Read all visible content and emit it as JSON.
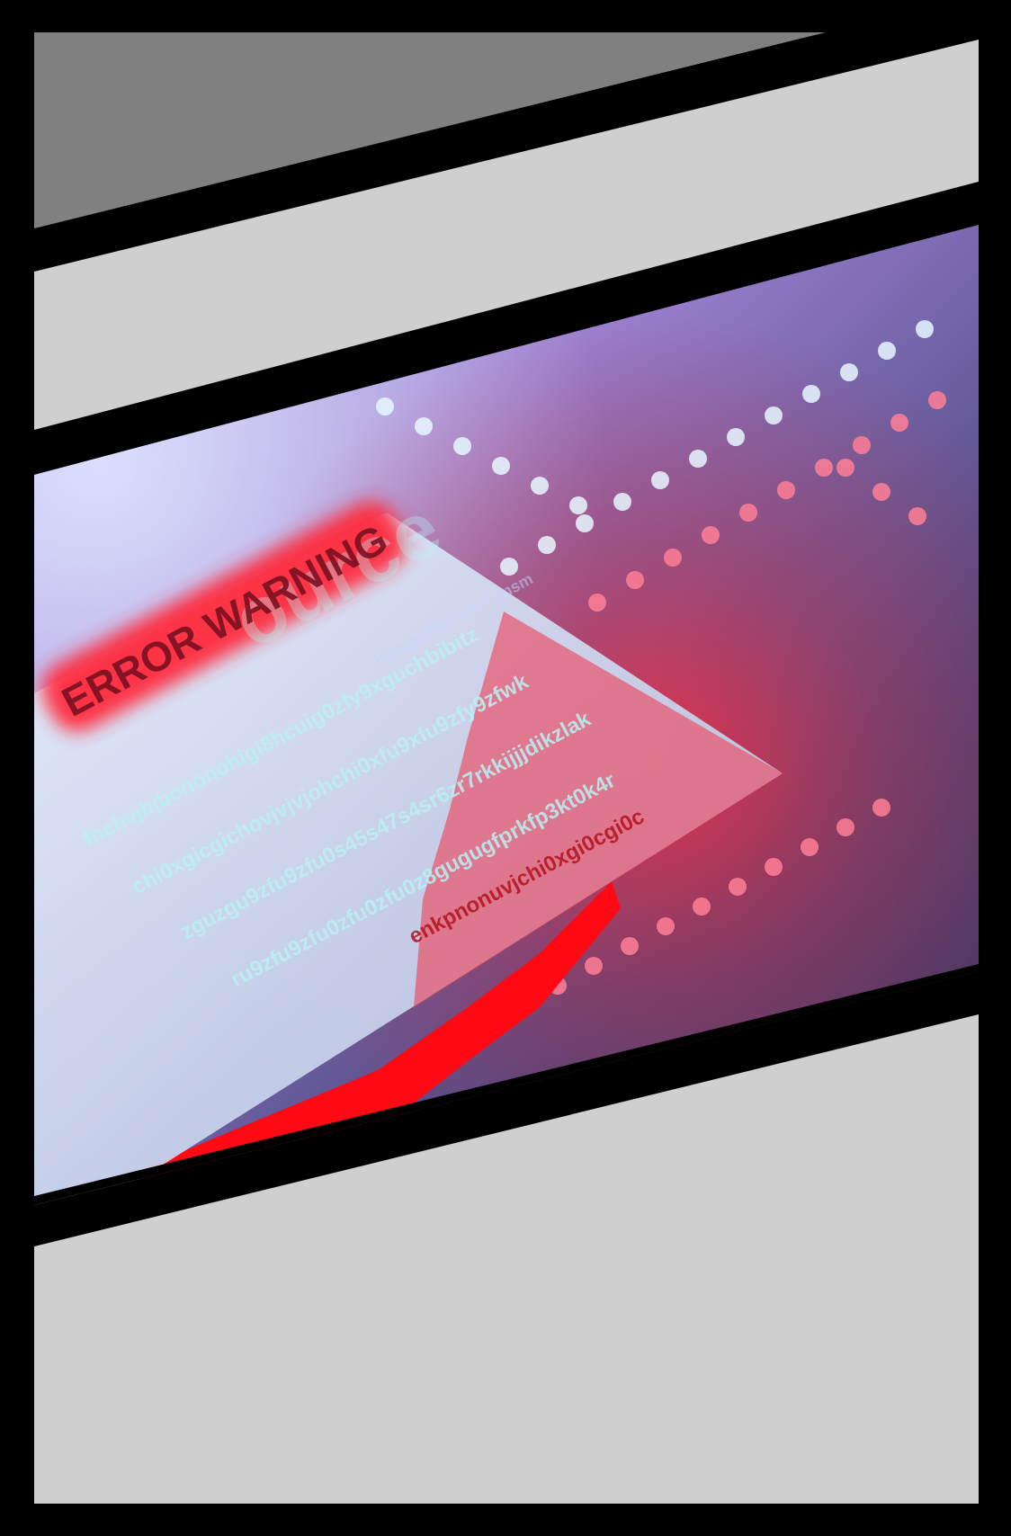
{
  "comic": {
    "panels": [
      {
        "id": "panel-1",
        "fill": "#808080",
        "content": "blank"
      },
      {
        "id": "panel-2",
        "fill": "#cfcfcf",
        "content": "blank"
      },
      {
        "id": "panel-3",
        "fill": "#cfcfcf",
        "content": "blank"
      },
      {
        "id": "panel-4",
        "fill": "gradient",
        "content": "illustration"
      },
      {
        "id": "panel-5",
        "fill": "#cfcfcf",
        "content": "blank"
      }
    ],
    "illustration": {
      "headline": "ERROR WARNING",
      "ghost_text": "ource",
      "code_lines": [
        "fhchvjbjbononohigi8hcuig0zfy9xguchbibitz",
        "chi0xgicgichovjvjvjohchi0xfu9xfu9zfy9zfwk",
        "zguzgu9zfu9zfu0s45s47s4sr6zr7rkkijjjdikzlak",
        "ru9zfu9zfu0zfu0zfu0z8gugugfprkfp3kt0k4r"
      ],
      "faded_lines": [
        "uuvrggr8hr7tisrnsmsm",
        "enkpnonuvjchi0xgi0cgi0c"
      ],
      "colors": {
        "alert_red": "#ff2b3d",
        "paper": "#d8e2f2",
        "text_cyan": "#b9f1f4",
        "dots_white": "#e8f8ff",
        "dots_pink": "#ff7f95",
        "bg_purple": "#9a80d0",
        "bg_navy": "#2d2f55"
      }
    }
  }
}
